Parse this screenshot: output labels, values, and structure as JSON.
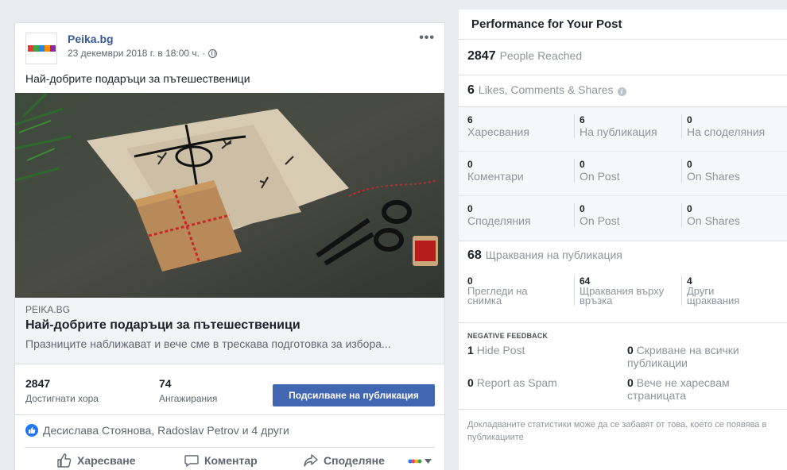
{
  "post": {
    "page_name": "Peika.bg",
    "avatar_text": "Peika.bg",
    "date": "23 декември 2018 г. в 18:00 ч. ·",
    "more_label": "•••",
    "text": "Най-добрите подаръци за пътешественици",
    "link": {
      "domain": "PEIKA.BG",
      "title": "Най-добрите подаръци за пътешественици",
      "description": "Празниците наближават и вече сме в трескава подготовка за избора..."
    },
    "stats": {
      "reached_value": "2847",
      "reached_label": "Достигнати хора",
      "engagements_value": "74",
      "engagements_label": "Ангажирания",
      "boost_button": "Подсилване на публикация"
    },
    "reactions_text": "Десислава Стоянова, Radoslav Petrov и 4 други",
    "actions": {
      "like": "Харесване",
      "comment": "Коментар",
      "share": "Споделяне"
    }
  },
  "performance": {
    "title": "Performance for Your Post",
    "people_reached_value": "2847",
    "people_reached_label": "People Reached",
    "likes_cs_value": "6",
    "likes_cs_label": "Likes, Comments & Shares",
    "rows": [
      [
        {
          "value": "6",
          "label": "Харесвания"
        },
        {
          "value": "6",
          "label": "На публикация"
        },
        {
          "value": "0",
          "label": "На споделяния"
        }
      ],
      [
        {
          "value": "0",
          "label": "Коментари"
        },
        {
          "value": "0",
          "label": "On Post"
        },
        {
          "value": "0",
          "label": "On Shares"
        }
      ],
      [
        {
          "value": "0",
          "label": "Споделяния"
        },
        {
          "value": "0",
          "label": "On Post"
        },
        {
          "value": "0",
          "label": "On Shares"
        }
      ]
    ],
    "clicks_value": "68",
    "clicks_label": "Щраквания на публикация",
    "clicks": [
      {
        "value": "0",
        "label_1": "Прегледи на",
        "label_2": "снимка"
      },
      {
        "value": "64",
        "label_1": "Щраквания върху",
        "label_2": "връзка"
      },
      {
        "value": "4",
        "label_1": "Други",
        "label_2": "щраквания"
      }
    ],
    "negative_title": "NEGATIVE FEEDBACK",
    "negative": {
      "hide_post_value": "1",
      "hide_post_label": "Hide Post",
      "hide_all_value": "0",
      "hide_all_label": "Скриване на всички публикации",
      "spam_value": "0",
      "spam_label": "Report as Spam",
      "unlike_value": "0",
      "unlike_label": "Вече не харесвам страницата"
    },
    "footnote": "Докладваните статистики може да се забавят от това, което се появява в публикациите"
  },
  "colors": {
    "brand_blue": "#4267b2",
    "link_blue": "#385898",
    "like_blue": "#2078f4"
  }
}
